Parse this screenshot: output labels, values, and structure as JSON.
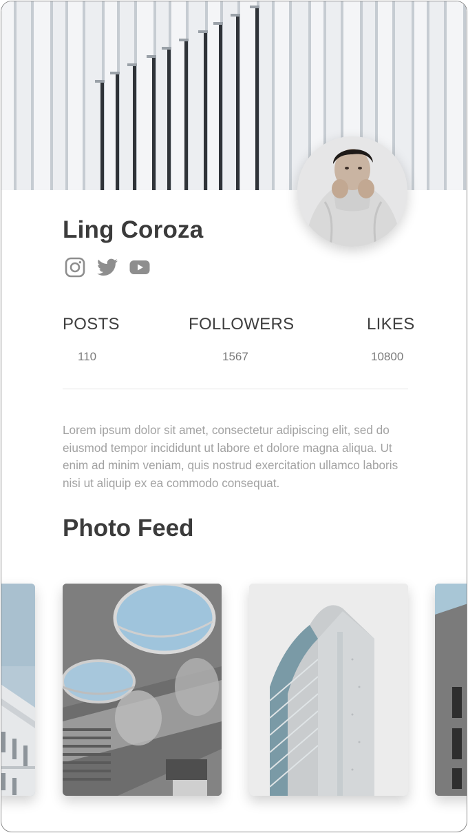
{
  "profile": {
    "name": "Ling Coroza",
    "socials": [
      "instagram-icon",
      "twitter-icon",
      "youtube-icon"
    ]
  },
  "stats": [
    {
      "label": "POSTS",
      "value": "110"
    },
    {
      "label": "FOLLOWERS",
      "value": "1567"
    },
    {
      "label": "LIKES",
      "value": "10800"
    }
  ],
  "bio": "Lorem ipsum dolor sit amet, consectetur adipiscing elit, sed do eiusmod tempor incididunt ut labore et dolore magna aliqua. Ut enim ad minim veniam, quis nostrud exercitation ullamco laboris nisi ut aliquip ex ea commodo consequat.",
  "feed": {
    "title": "Photo Feed",
    "photos": [
      "building-photo",
      "concrete-atrium-photo",
      "tower-photo",
      "facade-photo"
    ]
  },
  "colors": {
    "text_dark": "#3b3b3b",
    "text_muted": "#a2a2a2",
    "icon_gray": "#8e8e8e"
  }
}
